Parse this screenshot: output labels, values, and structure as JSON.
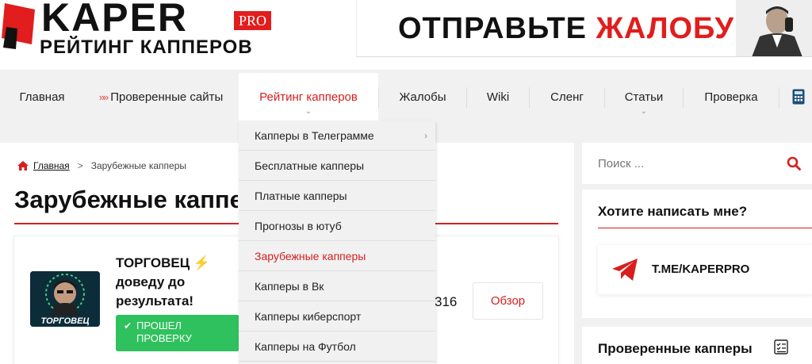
{
  "header": {
    "logo_main": "KAPER",
    "logo_pro": "PRO",
    "logo_sub": "РЕЙТИНГ КАППЕРОВ",
    "banner_part1": "ОТПРАВЬТЕ",
    "banner_part2": "ЖАЛОБУ"
  },
  "nav": {
    "items": [
      {
        "label": "Главная"
      },
      {
        "label": "Проверенные сайты",
        "prefix": "»»"
      },
      {
        "label": "Рейтинг капперов",
        "active": true
      },
      {
        "label": "Жалобы"
      },
      {
        "label": "Wiki"
      },
      {
        "label": "Сленг"
      },
      {
        "label": "Статьи"
      },
      {
        "label": "Проверка"
      }
    ]
  },
  "dropdown": {
    "items": [
      {
        "label": "Капперы в Телеграмме",
        "has_submenu": true
      },
      {
        "label": "Бесплатные капперы"
      },
      {
        "label": "Платные капперы"
      },
      {
        "label": "Прогнозы в ютуб"
      },
      {
        "label": "Зарубежные капперы",
        "active": true
      },
      {
        "label": "Капперы в Вк"
      },
      {
        "label": "Капперы киберспорт"
      },
      {
        "label": "Капперы на Футбол"
      }
    ]
  },
  "breadcrumb": {
    "home": "Главная",
    "separator": ">",
    "current": "Зарубежные капперы"
  },
  "page": {
    "title": "Зарубежные капперы"
  },
  "card": {
    "name": "ТОРГОВЕЦ ⚡ доведу до результата!",
    "avatar_text": "ТОРГОВЕЦ",
    "verified_label": "ПРОШЕЛ ПРОВЕРКУ",
    "number_fragment": "316",
    "review_label": "Обзор"
  },
  "sidebar": {
    "search_placeholder": "Поиск ...",
    "contact_title": "Хотите написать мне?",
    "telegram_label": "T.ME/KAPERPRO",
    "verified_title": "Проверенные капперы"
  },
  "colors": {
    "accent": "#d81e1e",
    "verified": "#2fc15d",
    "background": "#f1f1f1"
  }
}
